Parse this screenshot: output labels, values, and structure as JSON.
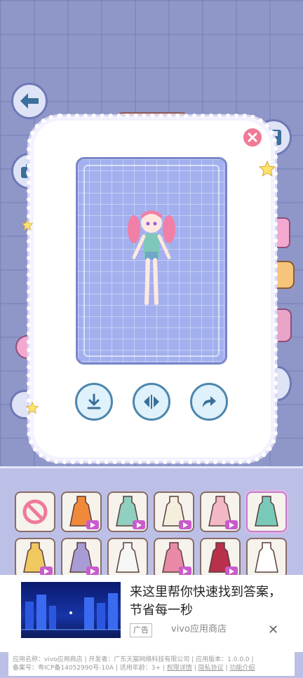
{
  "screen": {
    "side_buttons": [
      "back-arrow-icon",
      "camera-icon",
      "save-icon"
    ],
    "popup": {
      "actions": [
        "download-icon",
        "flip-icon",
        "share-icon"
      ]
    },
    "wardrobe": {
      "items": [
        {
          "name": "none",
          "video": false,
          "selected": false
        },
        {
          "name": "orange-dress",
          "video": true,
          "selected": false
        },
        {
          "name": "teal-dress",
          "video": true,
          "selected": false
        },
        {
          "name": "white-dress",
          "video": true,
          "selected": false
        },
        {
          "name": "floral-dress",
          "video": true,
          "selected": false
        },
        {
          "name": "teal-overalls",
          "video": false,
          "selected": true
        },
        {
          "name": "yellow-dress",
          "video": true,
          "selected": false
        },
        {
          "name": "purple-dress",
          "video": true,
          "selected": false
        },
        {
          "name": "checker-dress",
          "video": false,
          "selected": false
        },
        {
          "name": "pink-dress",
          "video": true,
          "selected": false
        },
        {
          "name": "red-dress",
          "video": true,
          "selected": false
        },
        {
          "name": "white-floral-dress",
          "video": false,
          "selected": false
        }
      ]
    }
  },
  "ad": {
    "title": "来这里帮你快速找到答案，节省每一秒",
    "tag": "广告",
    "store": "vivo应用商店",
    "close": "✕"
  },
  "footer": {
    "line1": "应用名称：vivo应用商店 | 开发者：广东天宸网络科技有限公司 | 应用版本：1.0.0.0 |",
    "line2_prefix": "备案号：粤ICP备14052990号-10A | 适用年龄：3+ | ",
    "link1": "权限详情",
    "sep1": " | ",
    "link2": "隐私协议",
    "sep2": " | ",
    "link3": "功能介绍"
  },
  "colors": {
    "accent": "#4c86ad",
    "close": "#f07a97",
    "video_badge": "#c85ccc"
  }
}
